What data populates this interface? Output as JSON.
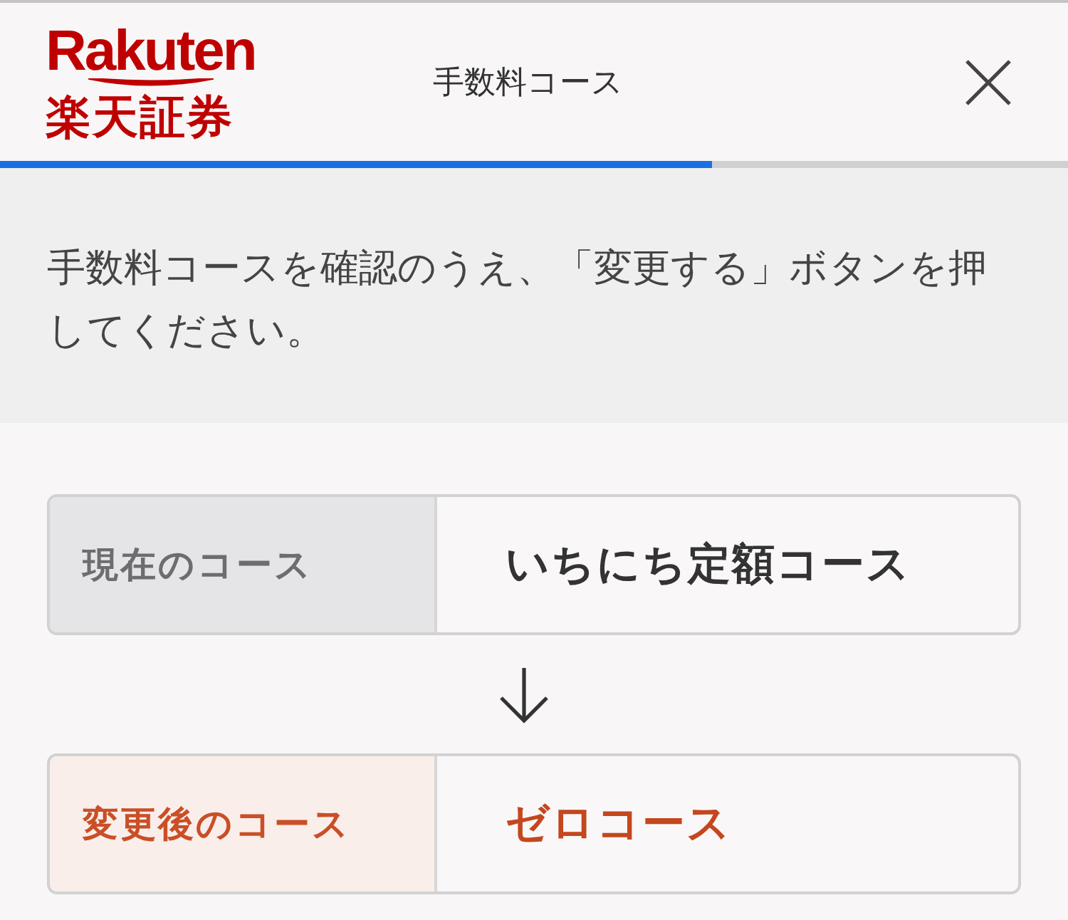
{
  "header": {
    "logo": {
      "wordmark": "Rakuten",
      "subtitle": "楽天証券"
    },
    "title": "手数料コース"
  },
  "progress": {
    "level": 0.667
  },
  "instruction": "手数料コースを確認のうえ、「変更する」ボタンを押してください。",
  "courses": [
    {
      "kind": "current",
      "label": "現在のコース",
      "name": "いちにち定額コース"
    },
    {
      "kind": "new",
      "label": "変更後のコース",
      "name": "ゼロコース"
    }
  ]
}
